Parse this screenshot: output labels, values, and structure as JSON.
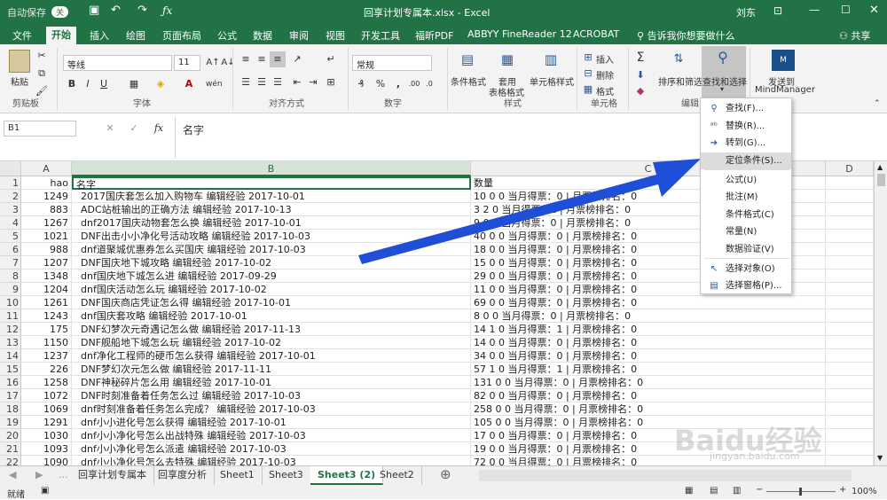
{
  "title_bar": {
    "autosave_label": "自动保存",
    "autosave_state": "关",
    "filename": "回享计划专属本.xlsx",
    "app": "Excel",
    "user": "刘东"
  },
  "tabs": [
    "文件",
    "开始",
    "插入",
    "绘图",
    "页面布局",
    "公式",
    "数据",
    "审阅",
    "视图",
    "开发工具",
    "福昕PDF",
    "ABBYY FineReader 12",
    "ACROBAT"
  ],
  "tell_me": "告诉我你想要做什么",
  "share": "共享",
  "ribbon": {
    "paste": "粘贴",
    "clipboard": "剪贴板",
    "font_name": "等线",
    "font_size": "11",
    "font_group": "字体",
    "align_group": "对齐方式",
    "number_format": "常规",
    "number_group": "数字",
    "cond_format": "条件格式",
    "table_format_1": "套用",
    "table_format_2": "表格格式",
    "cell_style": "单元格样式",
    "style_group": "样式",
    "insert": "插入",
    "delete": "删除",
    "format": "格式",
    "cells_group": "单元格",
    "sort_filter": "排序和筛选",
    "find_select": "查找和选择",
    "edit_group": "编辑",
    "send_to_1": "发送到",
    "send_to_2": "MindManager"
  },
  "formula_bar": {
    "name_box": "B1",
    "fx": "fx",
    "content": "名字"
  },
  "columns": [
    "A",
    "B",
    "C",
    "D"
  ],
  "rows": [
    {
      "n": "1",
      "a": "hao",
      "b": "名字",
      "c": "数量"
    },
    {
      "n": "2",
      "a": "1249",
      "b": "2017国庆套怎么加入购物车 编辑经验 2017-10-01",
      "c": "10 0 0 当月得票：0 | 月票榜排名：0"
    },
    {
      "n": "3",
      "a": "883",
      "b": "ADC站桩输出的正确方法 编辑经验 2017-10-13",
      "c": "3 2 0 当月得票：2 | 月票榜排名：0"
    },
    {
      "n": "4",
      "a": "1267",
      "b": "dnf2017国庆动物套怎么换 编辑经验 2017-10-01",
      "c": "9 0 0 当月得票：0 | 月票榜排名：0"
    },
    {
      "n": "5",
      "a": "1021",
      "b": "DNF出击小小净化号活动攻略 编辑经验 2017-10-03",
      "c": "40 0 0 当月得票：0 | 月票榜排名：0"
    },
    {
      "n": "6",
      "a": "988",
      "b": "dnf道聚城优惠券怎么买国庆 编辑经验 2017-10-03",
      "c": "18 0 0 当月得票：0 | 月票榜排名：0"
    },
    {
      "n": "7",
      "a": "1207",
      "b": "DNF国庆地下城攻略 编辑经验 2017-10-02",
      "c": "15 0 0 当月得票：0 | 月票榜排名：0"
    },
    {
      "n": "8",
      "a": "1348",
      "b": "dnf国庆地下城怎么进 编辑经验 2017-09-29",
      "c": "29 0 0 当月得票：0 | 月票榜排名：0"
    },
    {
      "n": "9",
      "a": "1204",
      "b": "dnf国庆活动怎么玩 编辑经验 2017-10-02",
      "c": "11 0 0 当月得票：0 | 月票榜排名：0"
    },
    {
      "n": "10",
      "a": "1261",
      "b": "DNF国庆商店凭证怎么得 编辑经验 2017-10-01",
      "c": "69 0 0 当月得票：0 | 月票榜排名：0"
    },
    {
      "n": "11",
      "a": "1243",
      "b": "dnf国庆套攻略 编辑经验 2017-10-01",
      "c": "8 0 0 当月得票：0 | 月票榜排名：0"
    },
    {
      "n": "12",
      "a": "175",
      "b": "DNF幻梦次元奇遇记怎么做 编辑经验 2017-11-13",
      "c": "14 1 0 当月得票：1 | 月票榜排名：0"
    },
    {
      "n": "13",
      "a": "1150",
      "b": "DNF舰船地下城怎么玩 编辑经验 2017-10-02",
      "c": "14 0 0 当月得票：0 | 月票榜排名：0"
    },
    {
      "n": "14",
      "a": "1237",
      "b": "dnf净化工程师的硬币怎么获得 编辑经验 2017-10-01",
      "c": "34 0 0 当月得票：0 | 月票榜排名：0"
    },
    {
      "n": "15",
      "a": "226",
      "b": "DNF梦幻次元怎么做 编辑经验 2017-11-11",
      "c": "57 1 0 当月得票：1 | 月票榜排名：0"
    },
    {
      "n": "16",
      "a": "1258",
      "b": "DNF神秘碎片怎么用 编辑经验 2017-10-01",
      "c": "131 0 0 当月得票：0 | 月票榜排名：0"
    },
    {
      "n": "17",
      "a": "1072",
      "b": "DNF时刻准备着任务怎么过 编辑经验 2017-10-03",
      "c": "82 0 0 当月得票：0 | 月票榜排名：0"
    },
    {
      "n": "18",
      "a": "1069",
      "b": "dnf时刻准备着任务怎么完成？ 编辑经验 2017-10-03",
      "c": "258 0 0 当月得票：0 | 月票榜排名：0"
    },
    {
      "n": "19",
      "a": "1291",
      "b": "dnf小小进化号怎么获得 编辑经验 2017-10-01",
      "c": "105 0 0 当月得票：0 | 月票榜排名：0"
    },
    {
      "n": "20",
      "a": "1030",
      "b": "dnf小小净化号怎么出战特殊 编辑经验 2017-10-03",
      "c": "17 0 0 当月得票：0 | 月票榜排名：0"
    },
    {
      "n": "21",
      "a": "1093",
      "b": "dnf小小净化号怎么派遣 编辑经验 2017-10-03",
      "c": "19 0 0 当月得票：0 | 月票榜排名：0"
    },
    {
      "n": "22",
      "a": "1090",
      "b": "dnf小小净化号怎么去特殊 编辑经验 2017-10-03",
      "c": "72 0 0 当月得票：0 | 月票榜排名：0"
    }
  ],
  "menu": [
    {
      "label": "查找(F)...",
      "icon": "search-icon"
    },
    {
      "label": "替换(R)...",
      "icon": "replace-icon"
    },
    {
      "label": "转到(G)...",
      "icon": "goto-arrow-icon"
    },
    {
      "label": "定位条件(S)...",
      "icon": ""
    },
    {
      "label": "公式(U)",
      "icon": ""
    },
    {
      "label": "批注(M)",
      "icon": ""
    },
    {
      "label": "条件格式(C)",
      "icon": ""
    },
    {
      "label": "常量(N)",
      "icon": ""
    },
    {
      "label": "数据验证(V)",
      "icon": ""
    },
    {
      "label": "选择对象(O)",
      "icon": "pointer-icon"
    },
    {
      "label": "选择窗格(P)...",
      "icon": "pane-icon"
    }
  ],
  "sheets": [
    "回享计划专属本",
    "回享度分析",
    "Sheet1",
    "Sheet3",
    "Sheet3 (2)",
    "Sheet2"
  ],
  "status": {
    "ready": "就绪",
    "zoom": "100%"
  },
  "watermark": "Baidu经验",
  "watermark_url": "jingyan.baidu.com",
  "accent": "#217346",
  "arrow_color": "#1f4fd6"
}
